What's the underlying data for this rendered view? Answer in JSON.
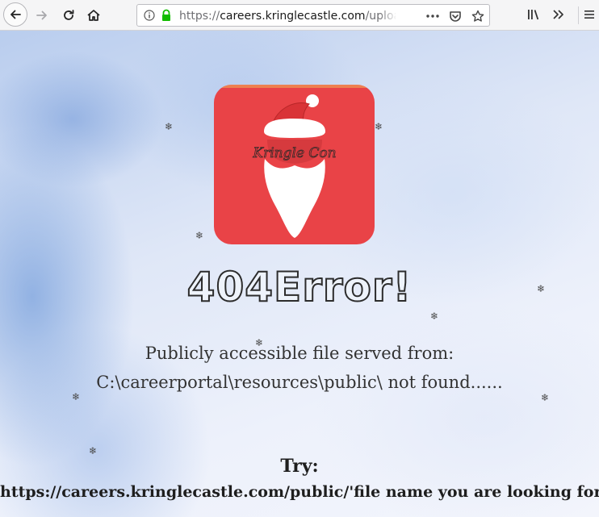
{
  "browser": {
    "url_scheme": "https://",
    "url_host": "careers.kringlecastle.com",
    "url_path": "/uploa",
    "icons": {
      "back": "back-arrow-icon",
      "forward": "forward-arrow-icon",
      "reload": "reload-icon",
      "home": "home-icon",
      "info": "info-icon",
      "lock": "lock-icon",
      "page_actions": "more-actions-icon",
      "pocket": "pocket-icon",
      "bookmark": "bookmark-star-icon",
      "library": "library-icon",
      "overflow": "overflow-chevron-icon",
      "menu": "hamburger-menu-icon"
    }
  },
  "page": {
    "logo_text": "Kringle Con",
    "headline": "404Error!",
    "message_line1": "Publicly accessible file served from:",
    "message_line2": "C:\\careerportal\\resources\\public\\ not found......",
    "try_label": "Try:",
    "try_url": "https://careers.kringlecastle.com/public/'file name you are looking for'",
    "snowflake_glyph": "❄",
    "colors": {
      "logo_background": "#e94347",
      "text": "#333333"
    }
  }
}
